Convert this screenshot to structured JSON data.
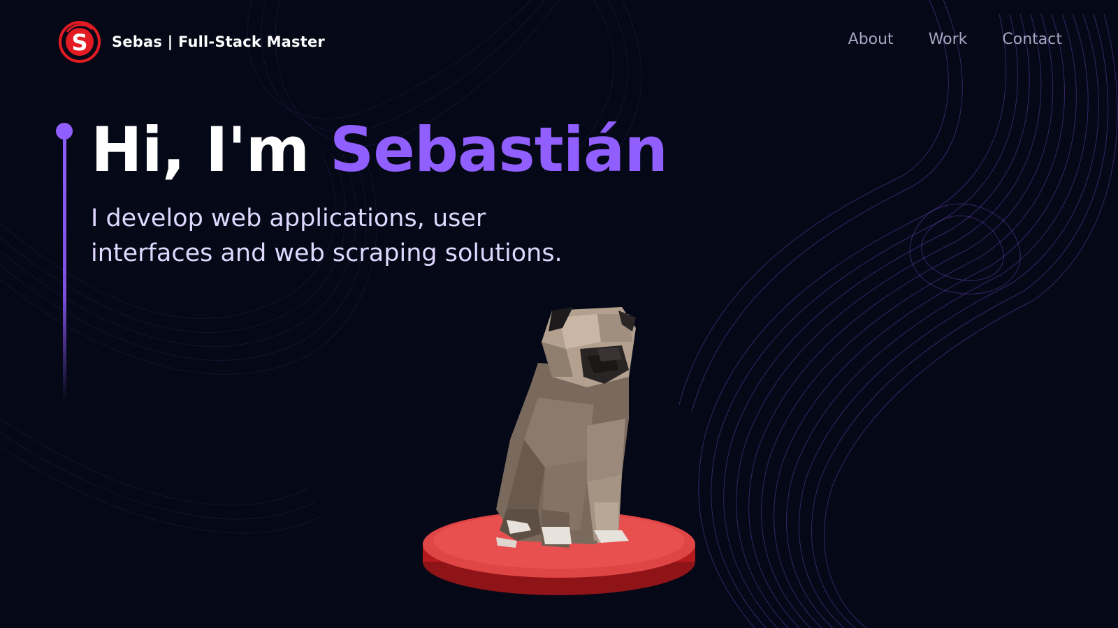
{
  "navbar": {
    "logo_icon": "s-logo-icon",
    "brand": "Sebas  | Full-Stack Master",
    "links": [
      {
        "label": "About"
      },
      {
        "label": "Work"
      },
      {
        "label": "Contact"
      }
    ]
  },
  "hero": {
    "greeting": "Hi, I'm ",
    "name": "Sebastián",
    "subtitle_line1": "I develop web applications, user",
    "subtitle_line2": "interfaces and web scraping solutions."
  },
  "model": {
    "icon": "low-poly-dog-on-pedestal"
  },
  "colors": {
    "background": "#050816",
    "accent": "#915eff",
    "logo_red": "#e31b23",
    "nav_text": "#aaa6c3",
    "subtitle_text": "#dfd9ff",
    "pedestal": "#e04545"
  }
}
